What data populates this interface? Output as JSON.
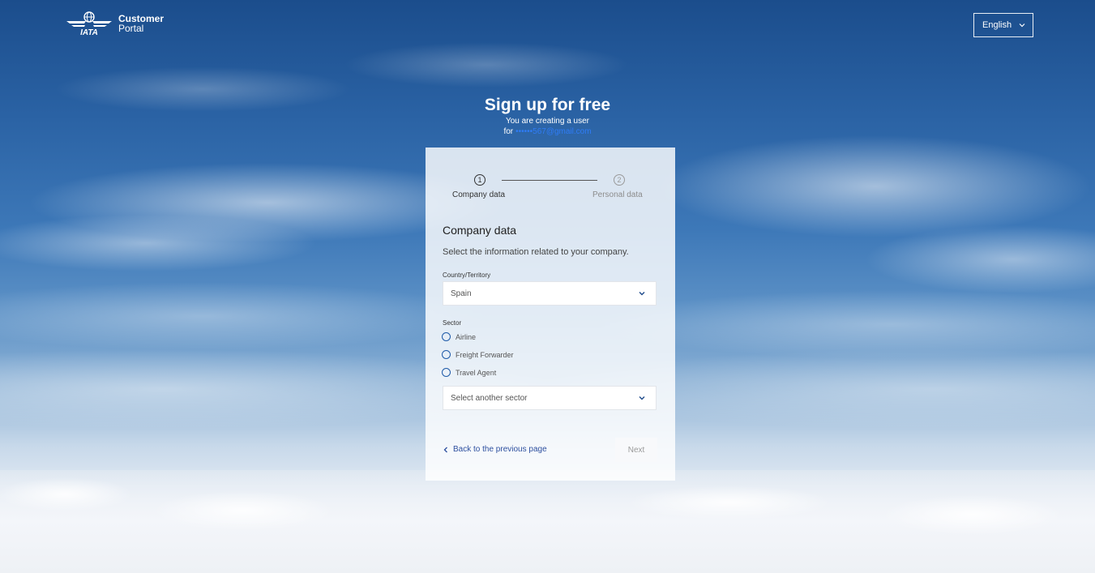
{
  "header": {
    "brand_name": "IATA",
    "brand_line1": "Customer",
    "brand_line2": "Portal",
    "language": "English"
  },
  "hero": {
    "title": "Sign up for free",
    "subtitle": "You are creating a user",
    "for_label": "for",
    "email": "••••••567@gmail.com"
  },
  "steps": [
    {
      "number": "1",
      "label": "Company data",
      "active": true
    },
    {
      "number": "2",
      "label": "Personal data",
      "active": false
    }
  ],
  "form": {
    "section_title": "Company data",
    "section_description": "Select the information related to your company.",
    "country_label": "Country/Territory",
    "country_value": "Spain",
    "sector_label": "Sector",
    "sector_options": [
      "Airline",
      "Freight Forwarder",
      "Travel Agent"
    ],
    "other_sector_placeholder": "Select another sector",
    "back_label": "Back to the previous page",
    "next_label": "Next"
  },
  "colors": {
    "link_blue": "#2d4f9f",
    "email_blue": "#2f7cf6",
    "radio_blue": "#1e5aa8"
  },
  "icons": [
    "iata-logo-icon",
    "chevron-down-icon",
    "chevron-left-icon"
  ]
}
